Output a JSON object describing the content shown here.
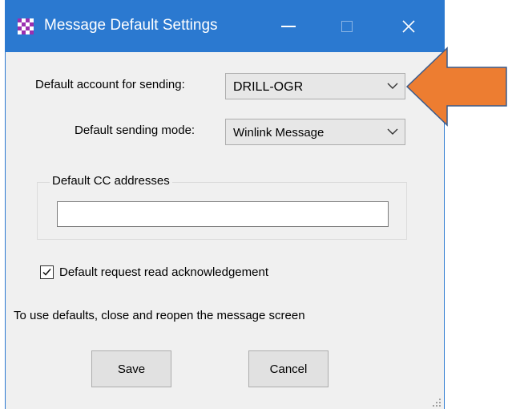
{
  "window": {
    "title": "Message Default Settings",
    "titlebar_color": "#2b79d0",
    "icon": "checkered-app-icon"
  },
  "titlebar_buttons": [
    "minimize-icon",
    "maximize-icon",
    "close-icon"
  ],
  "account": {
    "label": "Default account for sending:",
    "value": "DRILL-OGR"
  },
  "mode": {
    "label": "Default sending mode:",
    "value": "Winlink Message"
  },
  "cc": {
    "group_label": "Default CC addresses",
    "value": ""
  },
  "read_ack": {
    "label": "Default request read acknowledgement",
    "checked": true
  },
  "info_text": "To use defaults, close and reopen the message screen",
  "buttons": {
    "save": "Save",
    "cancel": "Cancel"
  },
  "annotation": {
    "arrow_color": "#ed7d31",
    "points_to": "account-combo"
  }
}
